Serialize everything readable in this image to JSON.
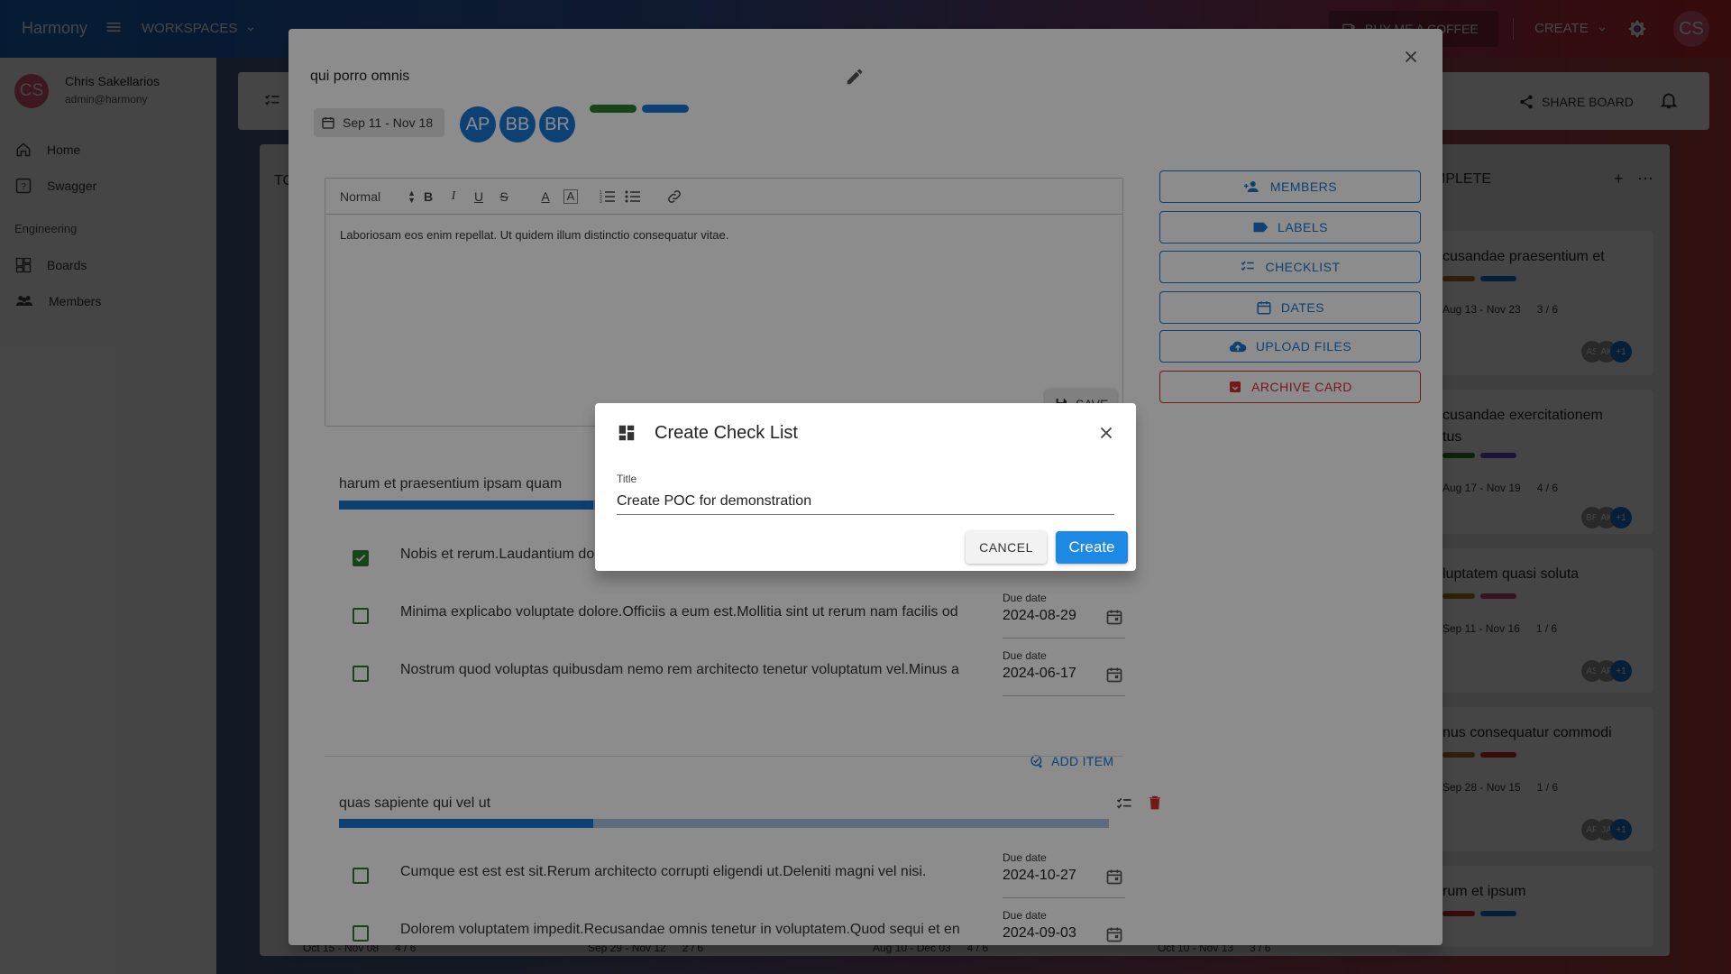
{
  "app": {
    "brand": "Harmony",
    "workspaces_label": "WORKSPACES",
    "coffee_label": "BUY ME A COFFEE",
    "create_label": "CREATE",
    "user_initials": "CS"
  },
  "sidebar": {
    "user_name": "Chris Sakellarios",
    "user_email": "admin@harmony",
    "items": [
      {
        "label": "Home",
        "icon": "home-icon"
      },
      {
        "label": "Swagger",
        "icon": "help-icon"
      }
    ],
    "group_label": "Engineering",
    "group_items": [
      {
        "label": "Boards",
        "icon": "dashboard-icon"
      },
      {
        "label": "Members",
        "icon": "group-icon"
      }
    ]
  },
  "board": {
    "share_label": "SHARE BOARD",
    "todo_label": "TO",
    "complete_label": "MPLETE",
    "cards": [
      {
        "title": "cusandae praesentium et",
        "dates": "Aug 13 - Nov 23",
        "checks": "3 / 6",
        "avatars": [
          "AS",
          "AK",
          "+1"
        ],
        "labels": [
          "#b56a2a",
          "#1976d2"
        ]
      },
      {
        "title": "cusandae exercitationem",
        "title2": "tus",
        "dates": "Aug 17 - Nov 19",
        "checks": "4 / 6",
        "avatars": [
          "BR",
          "AK",
          "+1"
        ],
        "labels": [
          "#2e7d32",
          "#6a4fc2"
        ]
      },
      {
        "title": "luptatem quasi soluta",
        "dates": "Sep 11 - Nov 16",
        "checks": "1 / 6",
        "avatars": [
          "AS",
          "AP",
          "+1"
        ],
        "labels": [
          "#a0821f",
          "#c2477a"
        ]
      },
      {
        "title": "nus consequatur commodi",
        "dates": "Sep 28 - Nov 15",
        "checks": "1 / 6",
        "avatars": [
          "AP",
          "JA",
          "+1"
        ],
        "labels": [
          "#b56a2a",
          "#c62828"
        ]
      },
      {
        "title": "rum et ipsum",
        "labels": [
          "#c62828",
          "#1976d2"
        ]
      }
    ],
    "footer": [
      {
        "dates": "Oct 15 - Nov 08",
        "checks": "4 / 6"
      },
      {
        "dates": "Sep 29 - Nov 12",
        "checks": "2 / 6"
      },
      {
        "dates": "Aug 10 - Dec 03",
        "checks": "4 / 6"
      },
      {
        "dates": "Oct 10 - Nov 13",
        "checks": "3 / 6"
      }
    ]
  },
  "card": {
    "title": "qui porro omnis",
    "dates": "Sep 11 - Nov 18",
    "members": [
      "AP",
      "BB",
      "BR"
    ],
    "labels": [
      "#2e7d32",
      "#1976d2"
    ],
    "editor": {
      "format": "Normal",
      "content": "Laboriosam eos enim repellat. Ut quidem illum distinctio consequatur vitae.",
      "save_label": "SAVE"
    },
    "actions": [
      {
        "label": "MEMBERS",
        "icon": "person-add-icon"
      },
      {
        "label": "LABELS",
        "icon": "label-icon"
      },
      {
        "label": "CHECKLIST",
        "icon": "checklist-icon"
      },
      {
        "label": "DATES",
        "icon": "calendar-edit-icon"
      },
      {
        "label": "UPLOAD FILES",
        "icon": "cloud-upload-icon"
      },
      {
        "label": "ARCHIVE CARD",
        "icon": "archive-icon"
      }
    ],
    "checklists": [
      {
        "title": "harum et praesentium ipsam quam",
        "progress": 0.33,
        "items": [
          {
            "text": "Nobis et rerum.Laudantium do",
            "checked": true,
            "due_label": "",
            "due": ""
          },
          {
            "text": "Minima explicabo voluptate dolore.Officiis a eum est.Mollitia sint ut rerum nam facilis od",
            "checked": false,
            "due_label": "Due date",
            "due": "2024-08-29"
          },
          {
            "text": "Nostrum quod voluptas quibusdam nemo rem architecto tenetur voluptatum vel.Minus a",
            "checked": false,
            "due_label": "Due date",
            "due": "2024-06-17"
          }
        ],
        "add_item_label": "ADD ITEM"
      },
      {
        "title": "quas sapiente qui vel ut",
        "progress": 0.33,
        "items": [
          {
            "text": "Cumque est est est sit.Rerum architecto corrupti eligendi ut.Deleniti magni vel nisi.",
            "checked": false,
            "due_label": "Due date",
            "due": "2024-10-27"
          },
          {
            "text": "Dolorem voluptatem impedit.Recusandae omnis tenetur in voluptatem.Quod sequi et en",
            "checked": false,
            "due_label": "Due date",
            "due": "2024-09-03"
          }
        ]
      }
    ]
  },
  "dialog": {
    "title": "Create Check List",
    "field_label": "Title",
    "field_value": "Create POC for demonstration",
    "cancel_label": "CANCEL",
    "create_label": "Create"
  },
  "colors": {
    "primary": "#1976d2",
    "danger": "#d32f2f",
    "success": "#2e7d32"
  }
}
